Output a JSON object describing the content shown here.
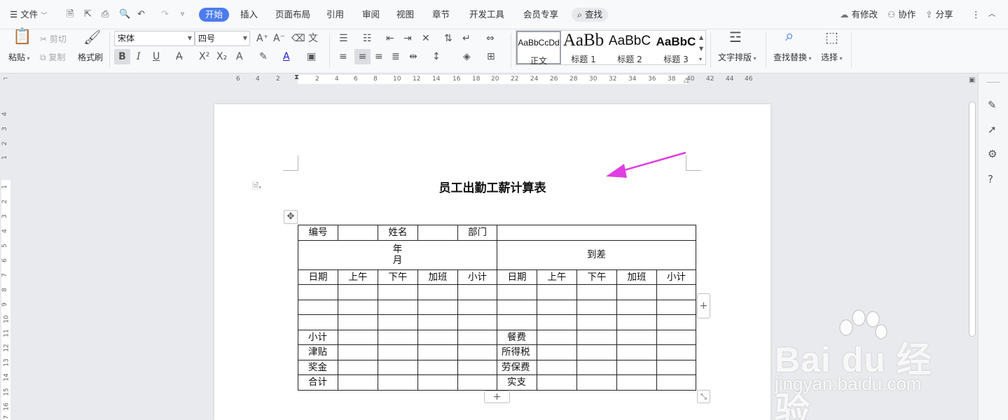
{
  "menubar": {
    "file_label": "文件",
    "tabs": [
      "开始",
      "插入",
      "页面布局",
      "引用",
      "审阅",
      "视图",
      "章节",
      "开发工具",
      "会员专享"
    ],
    "search_label": "查找",
    "modified_label": "有修改",
    "collab_label": "协作",
    "share_label": "分享"
  },
  "ribbon": {
    "paste": "粘贴",
    "cut": "剪切",
    "copy": "复制",
    "format_painter": "格式刷",
    "font_name": "宋体",
    "font_size": "四号",
    "styles": [
      {
        "sample": "AaBbCcDd",
        "name": "正文"
      },
      {
        "sample": "AaBb",
        "name": "标题 1"
      },
      {
        "sample": "AaBbC",
        "name": "标题 2"
      },
      {
        "sample": "AaBbC",
        "name": "标题 3"
      }
    ],
    "text_layout": "文字排版",
    "find_replace": "查找替换",
    "select": "选择"
  },
  "ruler": {
    "h_numbers": [
      "6",
      "4",
      "2",
      "2",
      "4",
      "6",
      "8",
      "10",
      "12",
      "14",
      "16",
      "18",
      "20",
      "22",
      "24",
      "26",
      "28",
      "30",
      "32",
      "34",
      "36",
      "38",
      "40",
      "42",
      "44",
      "46"
    ],
    "v_numbers": [
      "4",
      "3",
      "2",
      "1",
      "1",
      "2",
      "3",
      "4",
      "5",
      "6",
      "7",
      "8",
      "9",
      "10",
      "11",
      "12",
      "13",
      "14",
      "15",
      "16",
      "17"
    ]
  },
  "document": {
    "title": "员工出勤工薪计算表",
    "table": {
      "row1": [
        "编号",
        "",
        "姓名",
        "",
        "部门",
        ""
      ],
      "year_month_line1": "年",
      "year_month_line2": "月",
      "arrival": "到差",
      "header_row": [
        "日期",
        "上午",
        "下午",
        "加班",
        "小计",
        "日期",
        "上午",
        "下午",
        "加班",
        "小计"
      ],
      "summary_left": [
        "小计",
        "津贴",
        "奖金",
        "合计"
      ],
      "summary_right": [
        "餐费",
        "所得税",
        "劳保费",
        "实支"
      ]
    }
  },
  "watermark": {
    "brand": "Bai du 经验",
    "url": "jingyan.baidu.com"
  },
  "colors": {
    "accent": "#4c7cf0",
    "arrow": "#e03ee0"
  }
}
